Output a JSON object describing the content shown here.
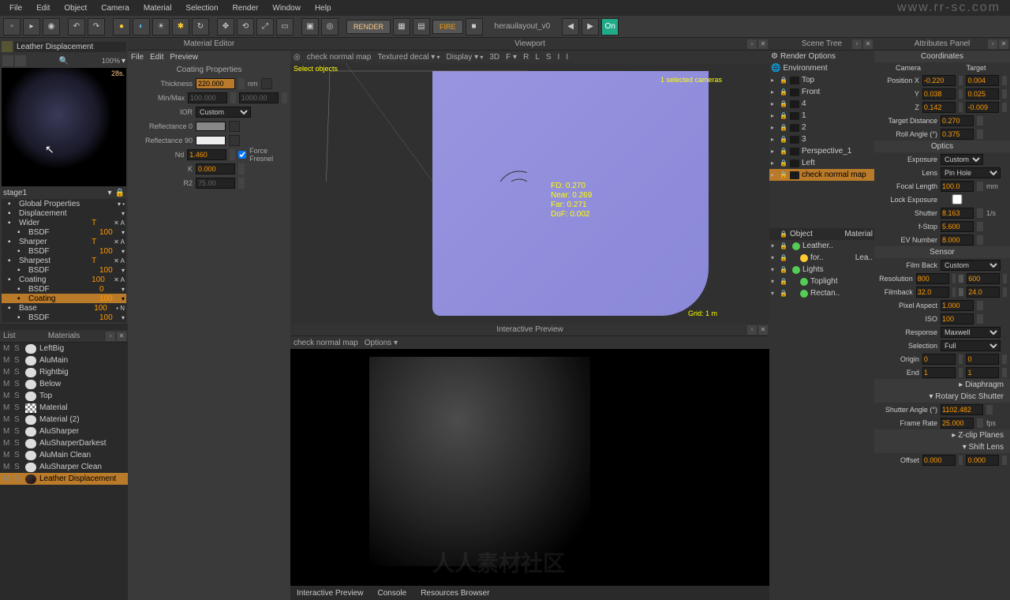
{
  "menu": [
    "File",
    "Edit",
    "Object",
    "Camera",
    "Material",
    "Selection",
    "Render",
    "Window",
    "Help"
  ],
  "watermark_url": "www.rr-sc.com",
  "watermark_text": "人人素材社区",
  "toolbar": {
    "render": "RENDER",
    "fire": "FIRE",
    "layout": "herauilayout_v0"
  },
  "material_editor": {
    "title": "Material Editor",
    "submenu": [
      "File",
      "Edit",
      "Preview"
    ],
    "material_name": "Leather Displacement",
    "zoom": "100%",
    "render_time": "28s.",
    "section": "Coating Properties",
    "thickness": {
      "label": "Thickness",
      "value": "220.000",
      "unit": "nm"
    },
    "minmax": {
      "label": "Min/Max",
      "min": "100.000",
      "max": "1000.00"
    },
    "ior": {
      "label": "IOR",
      "value": "Custom"
    },
    "refl0": {
      "label": "Reflectance 0"
    },
    "refl90": {
      "label": "Reflectance 90"
    },
    "nd": {
      "label": "Nd",
      "value": "1.460",
      "force": "Force Fresnel"
    },
    "k": {
      "label": "K",
      "value": "0.000"
    },
    "r2": {
      "label": "R2",
      "value": "75.00"
    },
    "stage": "stage1",
    "layers": [
      {
        "name": "Global Properties",
        "icon": "globe",
        "flags": "▾ •"
      },
      {
        "name": "Displacement",
        "icon": "disp",
        "flags": "▾"
      },
      {
        "name": "Wider",
        "icon": "folder",
        "val": "T",
        "flags": "✕ A"
      },
      {
        "name": "BSDF",
        "icon": "",
        "val": "100",
        "indent": 1,
        "flags": "▾"
      },
      {
        "name": "Sharper",
        "icon": "folder",
        "val": "T",
        "flags": "✕ A"
      },
      {
        "name": "BSDF",
        "icon": "",
        "val": "100",
        "indent": 1,
        "flags": "▾"
      },
      {
        "name": "Sharpest",
        "icon": "folder",
        "val": "T",
        "flags": "✕ A"
      },
      {
        "name": "BSDF",
        "icon": "",
        "val": "100",
        "indent": 1,
        "flags": "▾"
      },
      {
        "name": "Coating",
        "icon": "folder",
        "val": "100",
        "flags": "✕ A"
      },
      {
        "name": "BSDF",
        "icon": "",
        "val": "0",
        "indent": 1,
        "flags": "▾"
      },
      {
        "name": "Coating",
        "icon": "coat",
        "val": "100",
        "indent": 1,
        "sel": true,
        "flags": "▾"
      },
      {
        "name": "Base",
        "icon": "folder",
        "val": "100",
        "flags": "• N"
      },
      {
        "name": "BSDF",
        "icon": "",
        "val": "100",
        "indent": 1,
        "flags": "▾"
      }
    ]
  },
  "viewport": {
    "title": "Viewport",
    "tabs": [
      "check normal map",
      "Textured decal ▾",
      "Display ▾",
      "3D",
      "F ▾",
      "R",
      "L",
      "S",
      "I",
      "I"
    ],
    "select_objects": "Select objects",
    "selected_cameras": "1 selected cameras",
    "grid": "Grid: 1 m",
    "cam_info": {
      "fd": "FD: 0.270",
      "near": "Near: 0.269",
      "far": "Far: 0.271",
      "dof": "DoF: 0.002"
    }
  },
  "interactive": {
    "title": "Interactive Preview",
    "header": [
      "check normal map",
      "Options ▾"
    ],
    "footer_tabs": [
      "Interactive Preview",
      "Console",
      "Resources Browser"
    ]
  },
  "materials_list": {
    "panel": "List",
    "title": "Materials",
    "items": [
      {
        "name": "LeftBig",
        "sw": "w"
      },
      {
        "name": "AluMain",
        "sw": "w"
      },
      {
        "name": "Rightbig",
        "sw": "w"
      },
      {
        "name": "Below",
        "sw": "w"
      },
      {
        "name": "Top",
        "sw": "w"
      },
      {
        "name": "Material",
        "sw": "chk"
      },
      {
        "name": "Material (2)",
        "sw": "w"
      },
      {
        "name": "AluSharper",
        "sw": "w"
      },
      {
        "name": "AluSharperDarkest",
        "sw": "w"
      },
      {
        "name": "AluMain Clean",
        "sw": "w"
      },
      {
        "name": "AluSharper Clean",
        "sw": "w"
      },
      {
        "name": "Leather Displacement",
        "sw": "dk",
        "sel": true
      }
    ]
  },
  "scene_tree": {
    "title": "Scene Tree",
    "links": [
      "Render Options",
      "Environment"
    ],
    "cameras": [
      {
        "name": "Top"
      },
      {
        "name": "Front"
      },
      {
        "name": "4"
      },
      {
        "name": "1"
      },
      {
        "name": "2"
      },
      {
        "name": "3"
      },
      {
        "name": "Perspective_1"
      },
      {
        "name": "Left"
      },
      {
        "name": "check normal map",
        "sel": true
      }
    ],
    "obj_header": {
      "col1": "Object",
      "col2": "Material"
    },
    "objects": [
      {
        "name": "Leather..",
        "dot": "g",
        "mat": ""
      },
      {
        "name": "for..",
        "dot": "y",
        "mat": "Lea..",
        "indent": 1
      },
      {
        "name": "Lights",
        "dot": "g"
      },
      {
        "name": "Toplight",
        "dot": "g",
        "indent": 1
      },
      {
        "name": "Rectan..",
        "dot": "g",
        "indent": 1
      }
    ]
  },
  "attributes": {
    "title": "Attributes Panel",
    "coords": "Coordinates",
    "camera": "Camera",
    "target": "Target",
    "posx": {
      "label": "Position X",
      "v1": "-0.220",
      "v2": "0.004"
    },
    "posy": {
      "label": "Y",
      "v1": "0.038",
      "v2": "0.025"
    },
    "posz": {
      "label": "Z",
      "v1": "0.142",
      "v2": "-0.009"
    },
    "tdist": {
      "label": "Target Distance",
      "v": "0.270"
    },
    "roll": {
      "label": "Roll Angle (°)",
      "v": "0.375"
    },
    "optics": "Optics",
    "exposure": {
      "label": "Exposure",
      "v": "Custom"
    },
    "lens": {
      "label": "Lens",
      "v": "Pin Hole"
    },
    "focal": {
      "label": "Focal Length",
      "v": "100.0",
      "u": "mm"
    },
    "lockexp": "Lock Exposure",
    "shutter": {
      "label": "Shutter",
      "v": "8.163",
      "u": "1/s"
    },
    "fstop": {
      "label": "f-Stop",
      "v": "5.600"
    },
    "ev": {
      "label": "EV Number",
      "v": "8.000"
    },
    "sensor": "Sensor",
    "filmback": {
      "label": "Film Back",
      "v": "Custom"
    },
    "resolution": {
      "label": "Resolution",
      "v1": "800",
      "v2": "600"
    },
    "filmback2": {
      "label": "Filmback",
      "v1": "32.0",
      "v2": "24.0"
    },
    "pixelaspect": {
      "label": "Pixel Aspect",
      "v": "1.000"
    },
    "iso": {
      "label": "ISO",
      "v": "100"
    },
    "response": {
      "label": "Response",
      "v": "Maxwell"
    },
    "selection": {
      "label": "Selection",
      "v": "Full"
    },
    "origin": {
      "label": "Origin",
      "v1": "0",
      "v2": "0"
    },
    "end": {
      "label": "End",
      "v1": "1",
      "v2": "1"
    },
    "diaphragm": "Diaphragm",
    "rotary": "Rotary Disc Shutter",
    "shutterangle": {
      "label": "Shutter Angle (°)",
      "v": "1102.482"
    },
    "framerate": {
      "label": "Frame Rate",
      "v": "25.000",
      "u": "fps"
    },
    "zclip": "Z-clip Planes",
    "shiftlens": "Shift Lens",
    "offset": {
      "label": "Offset",
      "v1": "0.000",
      "v2": "0.000"
    }
  }
}
